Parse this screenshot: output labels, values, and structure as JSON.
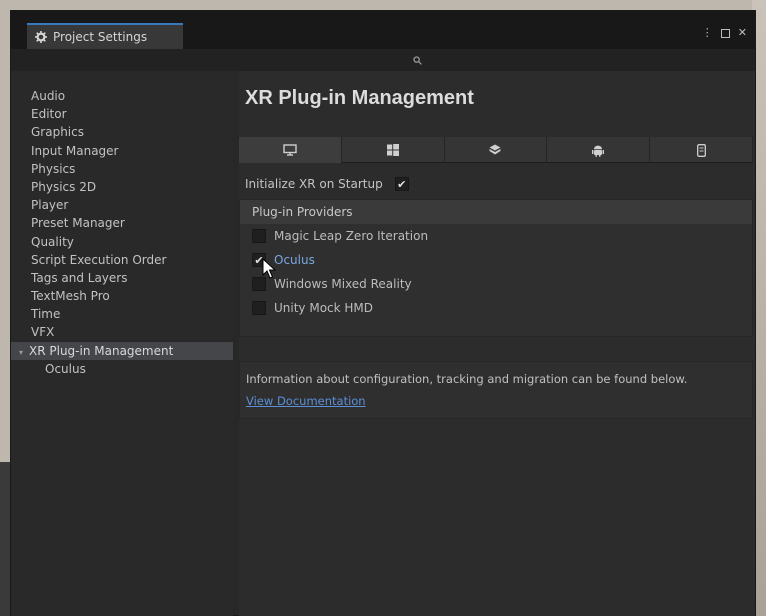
{
  "window": {
    "tab_title": "Project Settings",
    "controls": {
      "menu": "⋮",
      "close": "✕"
    }
  },
  "sidebar": {
    "items": [
      {
        "label": "Audio"
      },
      {
        "label": "Editor"
      },
      {
        "label": "Graphics"
      },
      {
        "label": "Input Manager"
      },
      {
        "label": "Physics"
      },
      {
        "label": "Physics 2D"
      },
      {
        "label": "Player"
      },
      {
        "label": "Preset Manager"
      },
      {
        "label": "Quality"
      },
      {
        "label": "Script Execution Order"
      },
      {
        "label": "Tags and Layers"
      },
      {
        "label": "TextMesh Pro"
      },
      {
        "label": "Time"
      },
      {
        "label": "VFX"
      },
      {
        "label": "XR Plug-in Management",
        "selected": true,
        "expanded": true
      },
      {
        "label": "Oculus",
        "child": true
      }
    ]
  },
  "main": {
    "title": "XR Plug-in Management",
    "platform_tabs": [
      {
        "icon": "monitor-icon",
        "active": true
      },
      {
        "icon": "windows-icon"
      },
      {
        "icon": "webgl-icon"
      },
      {
        "icon": "android-icon"
      },
      {
        "icon": "ios-icon"
      }
    ],
    "init_label": "Initialize XR on Startup",
    "init_checked": true,
    "providers_header": "Plug-in Providers",
    "providers": [
      {
        "label": "Magic Leap Zero Iteration",
        "checked": false
      },
      {
        "label": "Oculus",
        "checked": true
      },
      {
        "label": "Windows Mixed Reality",
        "checked": false
      },
      {
        "label": "Unity Mock HMD",
        "checked": false
      }
    ],
    "info_text": "Information about configuration, tracking and migration can be found below.",
    "info_link": "View Documentation"
  },
  "colors": {
    "accent": "#3a79bb",
    "link": "#5c8fd6",
    "window_bg": "#282828",
    "selected_row": "#44464a"
  }
}
